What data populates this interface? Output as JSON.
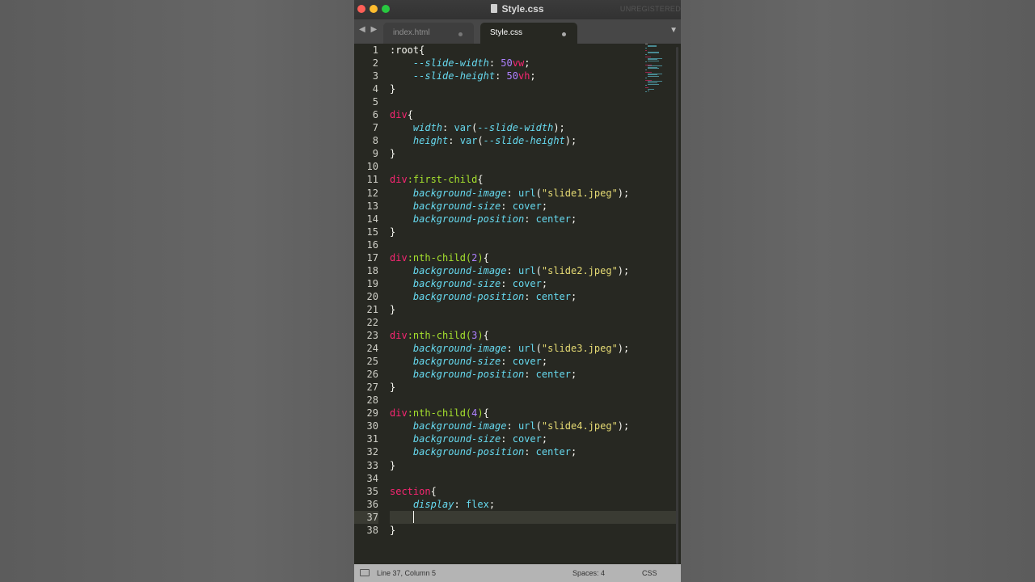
{
  "window": {
    "title": "Style.css",
    "unregistered": "UNREGISTERED"
  },
  "tabs": [
    {
      "label": "index.html",
      "active": false
    },
    {
      "label": "Style.css",
      "active": true
    }
  ],
  "editor": {
    "current_line": 37,
    "lines": [
      [
        [
          "t-sel",
          ":root"
        ],
        [
          "t-p",
          "{"
        ]
      ],
      [
        [
          "t-p",
          "    "
        ],
        [
          "t-var",
          "--slide-width"
        ],
        [
          "t-p",
          ": "
        ],
        [
          "t-num",
          "50"
        ],
        [
          "t-unit",
          "vw"
        ],
        [
          "t-p",
          ";"
        ]
      ],
      [
        [
          "t-p",
          "    "
        ],
        [
          "t-var",
          "--slide-height"
        ],
        [
          "t-p",
          ": "
        ],
        [
          "t-num",
          "50"
        ],
        [
          "t-unit",
          "vh"
        ],
        [
          "t-p",
          ";"
        ]
      ],
      [
        [
          "t-p",
          "}"
        ]
      ],
      [],
      [
        [
          "t-tag",
          "div"
        ],
        [
          "t-p",
          "{"
        ]
      ],
      [
        [
          "t-p",
          "    "
        ],
        [
          "t-prop",
          "width"
        ],
        [
          "t-p",
          ": "
        ],
        [
          "t-fn",
          "var"
        ],
        [
          "t-p",
          "("
        ],
        [
          "t-var",
          "--slide-width"
        ],
        [
          "t-p",
          ");"
        ]
      ],
      [
        [
          "t-p",
          "    "
        ],
        [
          "t-prop",
          "height"
        ],
        [
          "t-p",
          ": "
        ],
        [
          "t-fn",
          "var"
        ],
        [
          "t-p",
          "("
        ],
        [
          "t-var",
          "--slide-height"
        ],
        [
          "t-p",
          ");"
        ]
      ],
      [
        [
          "t-p",
          "}"
        ]
      ],
      [],
      [
        [
          "t-tag",
          "div"
        ],
        [
          "t-pc",
          ":first-child"
        ],
        [
          "t-p",
          "{"
        ]
      ],
      [
        [
          "t-p",
          "    "
        ],
        [
          "t-prop",
          "background-image"
        ],
        [
          "t-p",
          ": "
        ],
        [
          "t-fn",
          "url"
        ],
        [
          "t-p",
          "("
        ],
        [
          "t-str",
          "\"slide1.jpeg\""
        ],
        [
          "t-p",
          ");"
        ]
      ],
      [
        [
          "t-p",
          "    "
        ],
        [
          "t-prop",
          "background-size"
        ],
        [
          "t-p",
          ": "
        ],
        [
          "t-kw",
          "cover"
        ],
        [
          "t-p",
          ";"
        ]
      ],
      [
        [
          "t-p",
          "    "
        ],
        [
          "t-prop",
          "background-position"
        ],
        [
          "t-p",
          ": "
        ],
        [
          "t-kw",
          "center"
        ],
        [
          "t-p",
          ";"
        ]
      ],
      [
        [
          "t-p",
          "}"
        ]
      ],
      [],
      [
        [
          "t-tag",
          "div"
        ],
        [
          "t-pc",
          ":nth-child("
        ],
        [
          "t-num",
          "2"
        ],
        [
          "t-pc",
          ")"
        ],
        [
          "t-p",
          "{"
        ]
      ],
      [
        [
          "t-p",
          "    "
        ],
        [
          "t-prop",
          "background-image"
        ],
        [
          "t-p",
          ": "
        ],
        [
          "t-fn",
          "url"
        ],
        [
          "t-p",
          "("
        ],
        [
          "t-str",
          "\"slide2.jpeg\""
        ],
        [
          "t-p",
          ");"
        ]
      ],
      [
        [
          "t-p",
          "    "
        ],
        [
          "t-prop",
          "background-size"
        ],
        [
          "t-p",
          ": "
        ],
        [
          "t-kw",
          "cover"
        ],
        [
          "t-p",
          ";"
        ]
      ],
      [
        [
          "t-p",
          "    "
        ],
        [
          "t-prop",
          "background-position"
        ],
        [
          "t-p",
          ": "
        ],
        [
          "t-kw",
          "center"
        ],
        [
          "t-p",
          ";"
        ]
      ],
      [
        [
          "t-p",
          "}"
        ]
      ],
      [],
      [
        [
          "t-tag",
          "div"
        ],
        [
          "t-pc",
          ":nth-child("
        ],
        [
          "t-num",
          "3"
        ],
        [
          "t-pc",
          ")"
        ],
        [
          "t-p",
          "{"
        ]
      ],
      [
        [
          "t-p",
          "    "
        ],
        [
          "t-prop",
          "background-image"
        ],
        [
          "t-p",
          ": "
        ],
        [
          "t-fn",
          "url"
        ],
        [
          "t-p",
          "("
        ],
        [
          "t-str",
          "\"slide3.jpeg\""
        ],
        [
          "t-p",
          ");"
        ]
      ],
      [
        [
          "t-p",
          "    "
        ],
        [
          "t-prop",
          "background-size"
        ],
        [
          "t-p",
          ": "
        ],
        [
          "t-kw",
          "cover"
        ],
        [
          "t-p",
          ";"
        ]
      ],
      [
        [
          "t-p",
          "    "
        ],
        [
          "t-prop",
          "background-position"
        ],
        [
          "t-p",
          ": "
        ],
        [
          "t-kw",
          "center"
        ],
        [
          "t-p",
          ";"
        ]
      ],
      [
        [
          "t-p",
          "}"
        ]
      ],
      [],
      [
        [
          "t-tag",
          "div"
        ],
        [
          "t-pc",
          ":nth-child("
        ],
        [
          "t-num",
          "4"
        ],
        [
          "t-pc",
          ")"
        ],
        [
          "t-p",
          "{"
        ]
      ],
      [
        [
          "t-p",
          "    "
        ],
        [
          "t-prop",
          "background-image"
        ],
        [
          "t-p",
          ": "
        ],
        [
          "t-fn",
          "url"
        ],
        [
          "t-p",
          "("
        ],
        [
          "t-str",
          "\"slide4.jpeg\""
        ],
        [
          "t-p",
          ");"
        ]
      ],
      [
        [
          "t-p",
          "    "
        ],
        [
          "t-prop",
          "background-size"
        ],
        [
          "t-p",
          ": "
        ],
        [
          "t-kw",
          "cover"
        ],
        [
          "t-p",
          ";"
        ]
      ],
      [
        [
          "t-p",
          "    "
        ],
        [
          "t-prop",
          "background-position"
        ],
        [
          "t-p",
          ": "
        ],
        [
          "t-kw",
          "center"
        ],
        [
          "t-p",
          ";"
        ]
      ],
      [
        [
          "t-p",
          "}"
        ]
      ],
      [],
      [
        [
          "t-tag",
          "section"
        ],
        [
          "t-p",
          "{"
        ]
      ],
      [
        [
          "t-p",
          "    "
        ],
        [
          "t-prop",
          "display"
        ],
        [
          "t-p",
          ": "
        ],
        [
          "t-kw",
          "flex"
        ],
        [
          "t-p",
          ";"
        ]
      ],
      [
        [
          "t-p",
          "    "
        ]
      ],
      [
        [
          "t-p",
          "}"
        ]
      ]
    ]
  },
  "statusbar": {
    "position": "Line 37, Column 5",
    "spaces": "Spaces: 4",
    "syntax": "CSS"
  }
}
